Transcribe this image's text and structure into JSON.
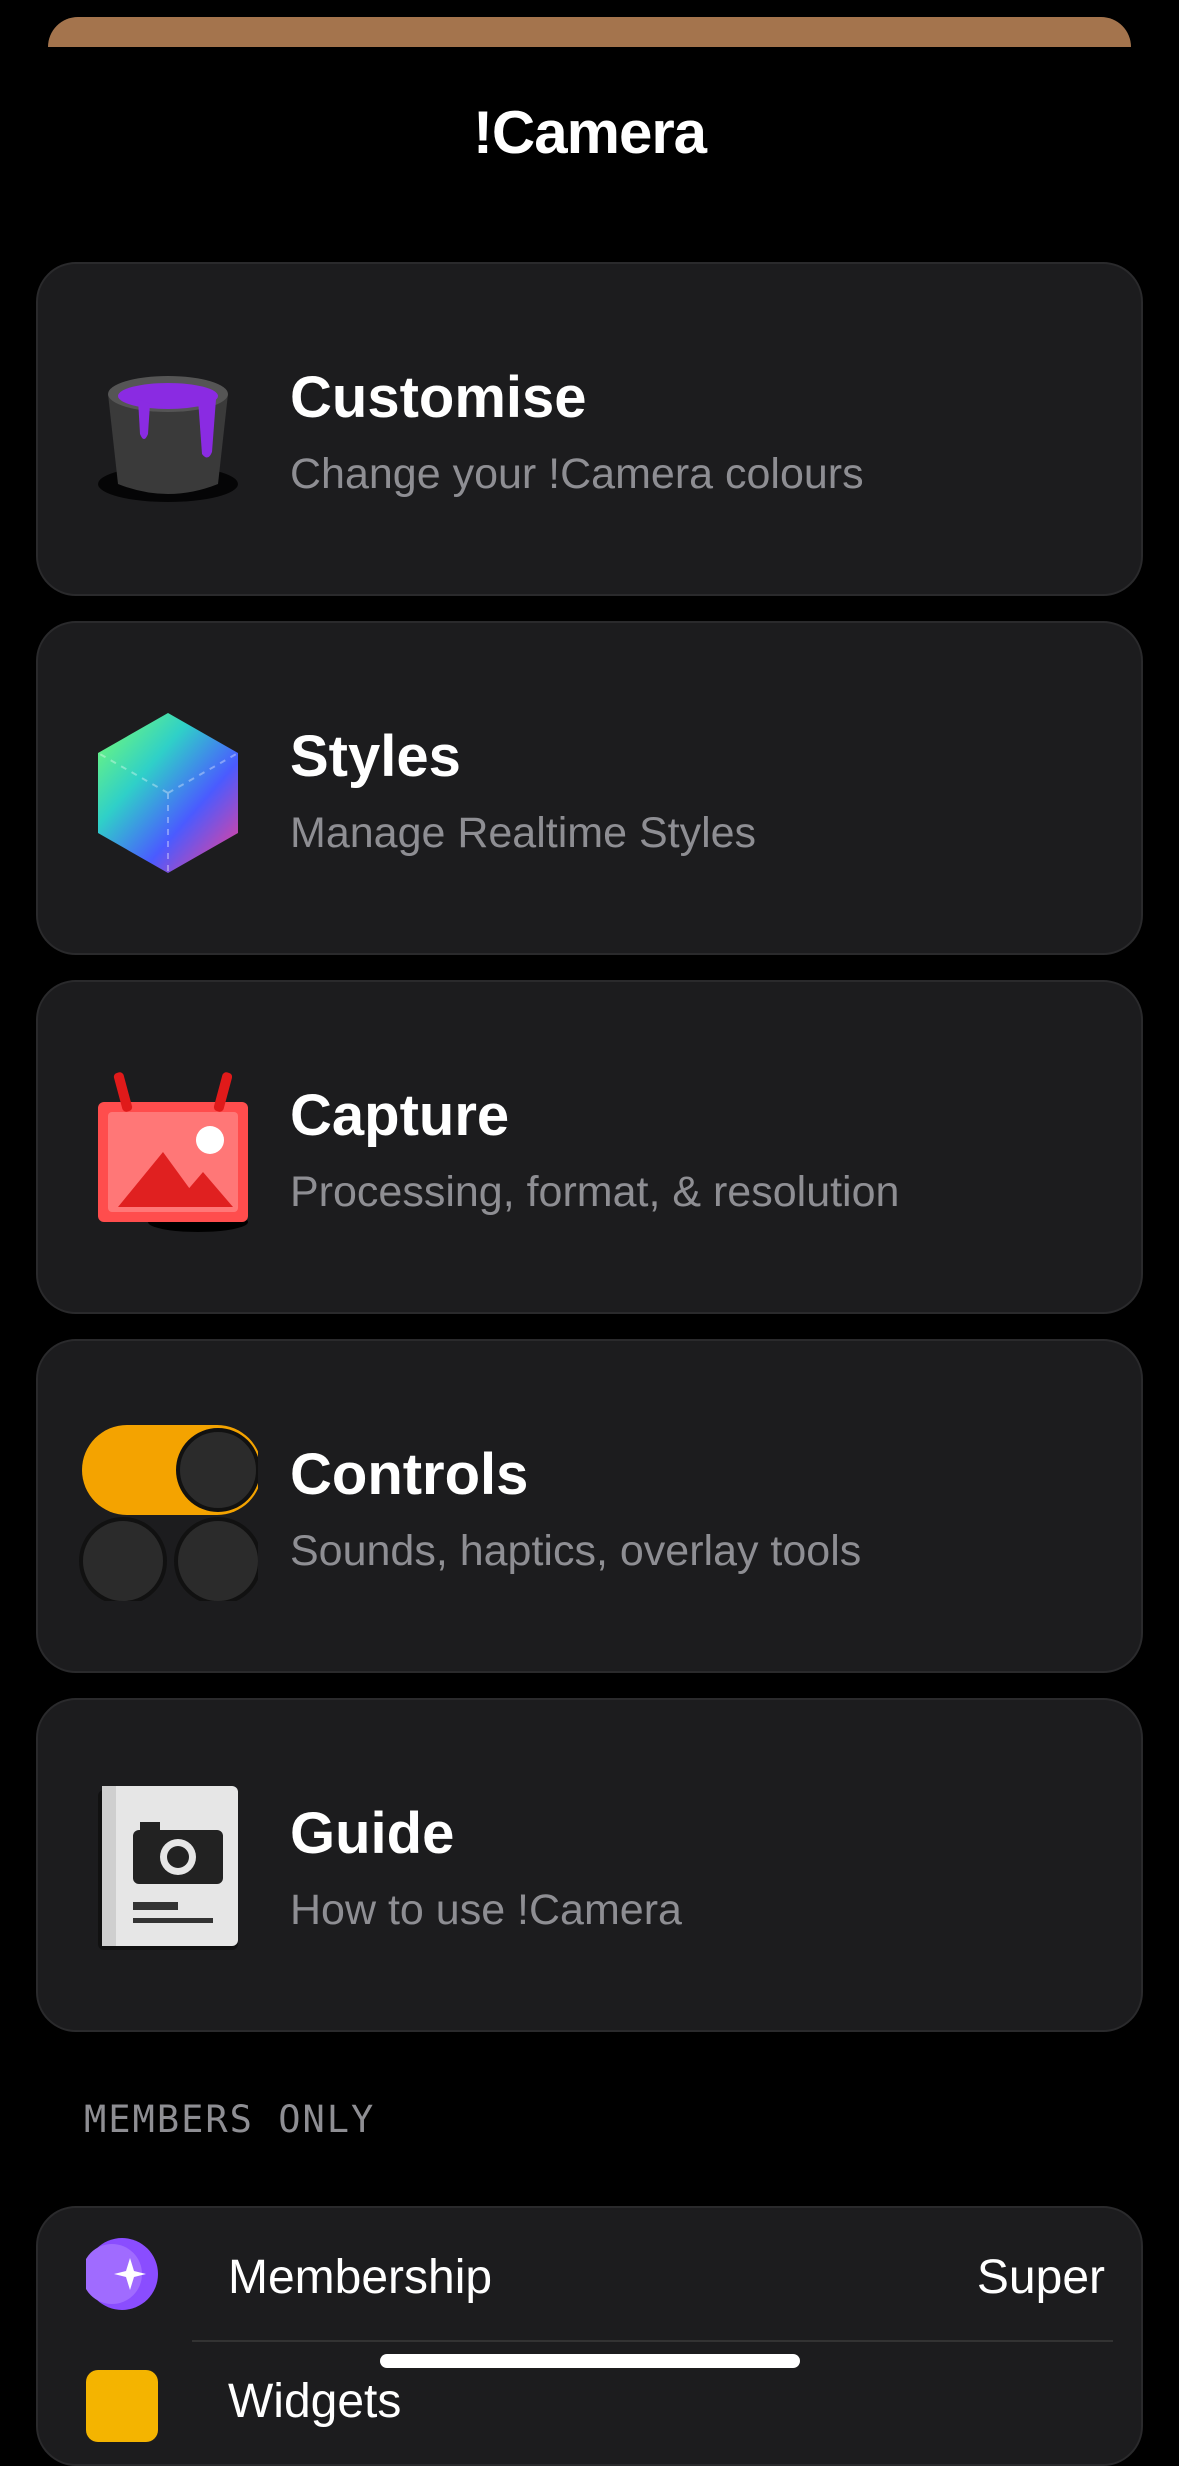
{
  "header": {
    "title": "!Camera"
  },
  "cards": [
    {
      "label": "Customise",
      "sub": "Change your !Camera colours"
    },
    {
      "label": "Styles",
      "sub": "Manage Realtime Styles"
    },
    {
      "label": "Capture",
      "sub": "Processing, format, & resolution"
    },
    {
      "label": "Controls",
      "sub": "Sounds, haptics, overlay tools"
    },
    {
      "label": "Guide",
      "sub": "How to use !Camera"
    }
  ],
  "members": {
    "header": "MEMBERS ONLY",
    "rows": [
      {
        "label": "Membership",
        "value": "Super"
      },
      {
        "label": "Widgets"
      }
    ]
  },
  "colors": {
    "accent_sheet": "#a4744d",
    "card_bg": "#1c1c1e",
    "muted_text": "#8e8e93"
  }
}
